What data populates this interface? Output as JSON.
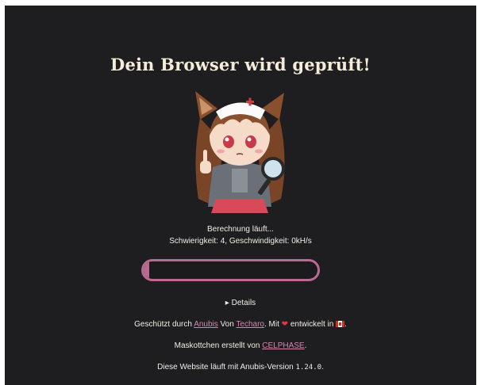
{
  "page": {
    "title": "Dein Browser wird geprüft!",
    "status_line1": "Berechnung läuft...",
    "status_line2": "Schwierigkeit: 4, Geschwindigkeit: 0kH/s",
    "progress": 0.03,
    "details_label": "Details",
    "details_icon": "triangle-right-icon"
  },
  "footer": {
    "protected_by": "Geschützt durch",
    "anubis_link": "Anubis",
    "from": "Von",
    "techaro_link": "Techaro",
    "with": ". Mit",
    "heart_icon": "heart-icon",
    "developed_in": "entwickelt in",
    "flag_icon": "canada-flag-icon",
    "period": ".",
    "mascot_credit": "Maskottchen erstellt von",
    "celphase_link": "CELPHASE",
    "version_prefix": "Diese Website läuft mit Anubis-Version",
    "version": "1.24.0"
  },
  "colors": {
    "background": "#1e1e20",
    "accent": "#b86a91",
    "link": "#d486ae",
    "text": "#f1ede4"
  }
}
